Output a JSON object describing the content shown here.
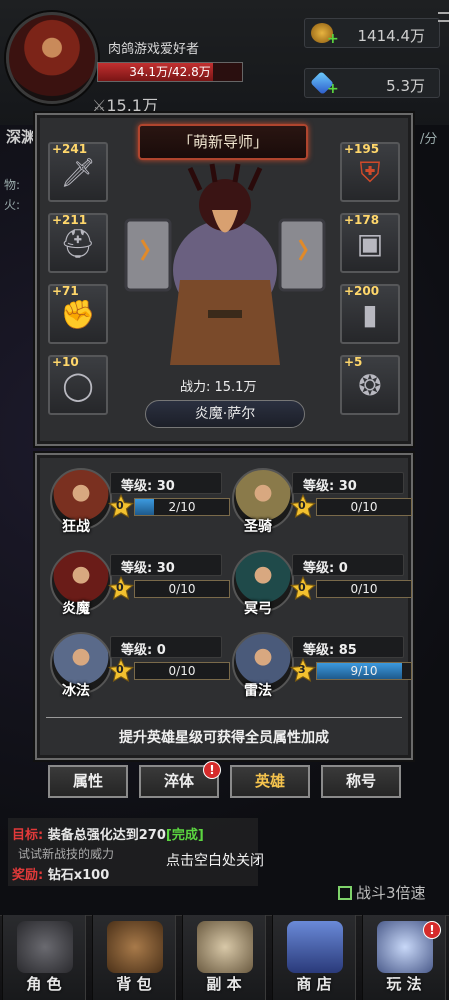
{
  "player": {
    "name": "肉鸽游戏爱好者",
    "hp_text": "34.1万/42.8万",
    "hp_fraction": 0.797,
    "power": "15.1万"
  },
  "resources": {
    "gold": "1414.4万",
    "gems": "5.3万"
  },
  "background": {
    "left_title": "深渊",
    "per_min": "/分",
    "stat1": "物:",
    "stat2": "火:"
  },
  "hero_panel": {
    "title": "「萌新导师」",
    "power_label": "战力: 15.1万",
    "hero_name": "炎魔·萨尔",
    "left_slots": [
      {
        "bonus": "+241",
        "icon": "sword-icon"
      },
      {
        "bonus": "+211",
        "icon": "helmet-icon"
      },
      {
        "bonus": "+71",
        "icon": "gauntlet-icon"
      },
      {
        "bonus": "+10",
        "icon": "ring-icon"
      }
    ],
    "right_slots": [
      {
        "bonus": "+195",
        "icon": "shield-icon"
      },
      {
        "bonus": "+178",
        "icon": "armor-icon"
      },
      {
        "bonus": "+200",
        "icon": "boots-icon"
      },
      {
        "bonus": "+5",
        "icon": "amulet-icon"
      }
    ]
  },
  "heroes": [
    {
      "name": "狂战",
      "level": "等级: 30",
      "stars": "0",
      "progress": "2/10",
      "fraction": 0.2,
      "color": "#7a3020"
    },
    {
      "name": "圣骑",
      "level": "等级: 30",
      "stars": "0",
      "progress": "0/10",
      "fraction": 0,
      "color": "#8a7a4a"
    },
    {
      "name": "炎魔",
      "level": "等级: 30",
      "stars": "0",
      "progress": "0/10",
      "fraction": 0,
      "color": "#6a1c18"
    },
    {
      "name": "冥弓",
      "level": "等级: 0",
      "stars": "0",
      "progress": "0/10",
      "fraction": 0,
      "color": "#1f4a4a"
    },
    {
      "name": "冰法",
      "level": "等级: 0",
      "stars": "0",
      "progress": "0/10",
      "fraction": 0,
      "color": "#5a6a8a"
    },
    {
      "name": "雷法",
      "level": "等级: 85",
      "stars": "3",
      "progress": "9/10",
      "fraction": 0.9,
      "color": "#4a5a7a"
    }
  ],
  "tip": "提升英雄星级可获得全员属性加成",
  "tabs": [
    {
      "label": "属性",
      "active": false,
      "badge": false
    },
    {
      "label": "淬体",
      "active": false,
      "badge": true
    },
    {
      "label": "英雄",
      "active": true,
      "badge": false
    },
    {
      "label": "称号",
      "active": false,
      "badge": false
    }
  ],
  "quest": {
    "goal_label": "目标:",
    "goal_text": "装备总强化达到270",
    "goal_status": "[完成]",
    "hint": "试试新战技的威力",
    "reward_label": "奖励:",
    "reward_text": "钻石x100"
  },
  "close_hint": "点击空白处关闭",
  "battle_speed": "战斗3倍速",
  "nav": [
    {
      "label": "角 色",
      "icon": "character-icon"
    },
    {
      "label": "背 包",
      "icon": "backpack-icon"
    },
    {
      "label": "副 本",
      "icon": "skull-icon"
    },
    {
      "label": "商 店",
      "icon": "shop-icon"
    },
    {
      "label": "玩 法",
      "icon": "gameplay-icon"
    }
  ],
  "badge_text": "!",
  "colors": {
    "accent_gold": "#f5c34d",
    "hp_red": "#c23030",
    "progress_blue": "#3c9adf"
  }
}
